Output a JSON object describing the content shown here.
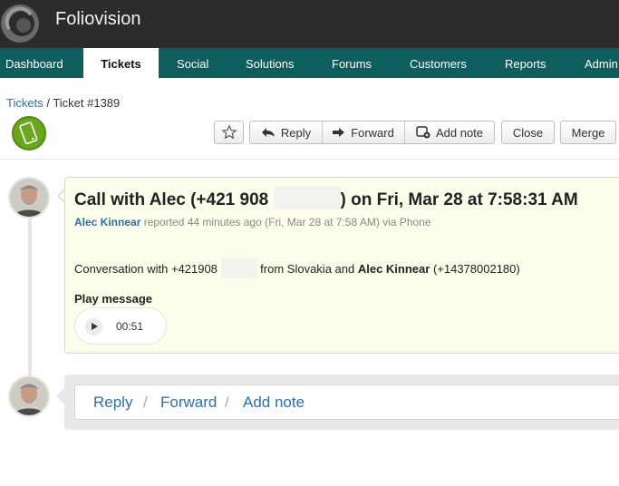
{
  "app": {
    "title": "Foliovision"
  },
  "nav": {
    "items": [
      {
        "label": "Dashboard",
        "active": false
      },
      {
        "label": "Tickets",
        "active": true
      },
      {
        "label": "Social",
        "active": false
      },
      {
        "label": "Solutions",
        "active": false
      },
      {
        "label": "Forums",
        "active": false
      },
      {
        "label": "Customers",
        "active": false
      },
      {
        "label": "Reports",
        "active": false
      },
      {
        "label": "Admin",
        "active": false
      }
    ]
  },
  "breadcrumb": {
    "root": "Tickets",
    "separator": " / ",
    "current": "Ticket #1389"
  },
  "channel": {
    "icon": "phone-icon",
    "color": "#6aa61e"
  },
  "toolbar": {
    "star_icon": "star-icon",
    "reply_label": "Reply",
    "forward_label": "Forward",
    "add_note_label": "Add note",
    "close_label": "Close",
    "merge_label": "Merge"
  },
  "event": {
    "title_prefix": "Call with Alec (+421 908",
    "title_suffix": ") on Fri, Mar 28 at 7:58:31 AM",
    "author": "Alec Kinnear",
    "meta": " reported 44 minutes ago (Fri, Mar 28 at 7:58 AM) via Phone",
    "body_prefix": "Conversation with +421908",
    "body_middle": " from Slovakia and ",
    "body_name": "Alec Kinnear",
    "body_suffix": " (+14378002180)",
    "play_label": "Play message",
    "duration": "00:51"
  },
  "reply_box": {
    "reply": "Reply",
    "forward": "Forward",
    "add_note": "Add note",
    "separator": "/"
  },
  "colors": {
    "accent": "#0e5e5e",
    "link": "#2f6ea5",
    "card": "#fdfdec"
  }
}
